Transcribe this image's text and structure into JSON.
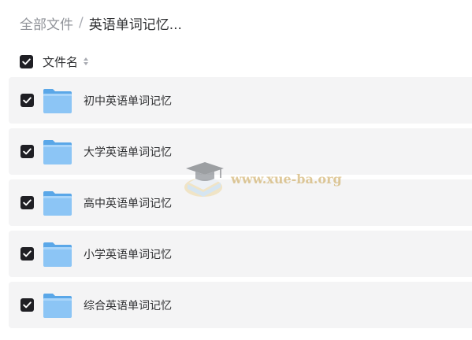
{
  "breadcrumb": {
    "root": "全部文件",
    "separator": "/",
    "current": "英语单词记忆..."
  },
  "list_header": {
    "column_label": "文件名",
    "select_all_checked": true,
    "sort_icon": "sort-icon"
  },
  "files": [
    {
      "name": "初中英语单词记忆",
      "type": "folder",
      "checked": true
    },
    {
      "name": "大学英语单词记忆",
      "type": "folder",
      "checked": true
    },
    {
      "name": "高中英语单词记忆",
      "type": "folder",
      "checked": true
    },
    {
      "name": "小学英语单词记忆",
      "type": "folder",
      "checked": true
    },
    {
      "name": "综合英语单词记忆",
      "type": "folder",
      "checked": true
    }
  ],
  "watermark": {
    "text": "www.xue-ba.org",
    "icon": "graduation-cap-icon"
  },
  "colors": {
    "checkbox": "#1f1f24",
    "row_background": "#f4f4f5",
    "folder": "#79b8f0",
    "breadcrumb_root": "#909399",
    "watermark": "#c8a04a"
  }
}
